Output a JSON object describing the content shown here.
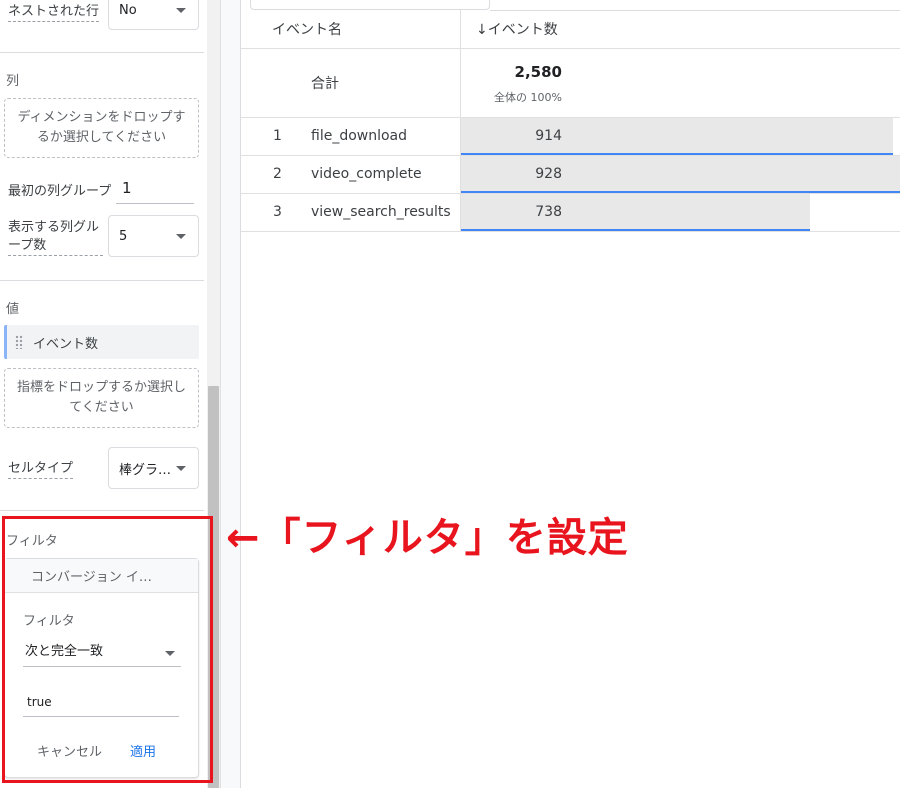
{
  "panel": {
    "nested_rows": {
      "label": "ネストされた行",
      "value": "No"
    },
    "columns": {
      "section_label": "列",
      "dropzone": "ディメンションをドロップするか選択してください",
      "first_group_label": "最初の列グループ",
      "first_group_value": "1",
      "show_groups_label": "表示する列グループ数",
      "show_groups_value": "5"
    },
    "values": {
      "section_label": "値",
      "chip": "イベント数",
      "dropzone": "指標をドロップするか選択してください"
    },
    "cell_type": {
      "label": "セルタイプ",
      "value": "棒グラ…"
    },
    "filter": {
      "section_label": "フィルタ",
      "chip": "コンバージョン イ…",
      "field_label": "フィルタ",
      "match_type": "次と完全一致",
      "value": "true",
      "cancel_label": "キャンセル",
      "apply_label": "適用"
    }
  },
  "table": {
    "col_event_name": "イベント名",
    "col_event_count": "↓イベント数",
    "total_label": "合計",
    "total_value": "2,580",
    "total_pct": "全体の 100%",
    "rows": [
      {
        "idx": "1",
        "name": "file_download",
        "value": "914",
        "fraction": 0.985
      },
      {
        "idx": "2",
        "name": "video_complete",
        "value": "928",
        "fraction": 1.0
      },
      {
        "idx": "3",
        "name": "view_search_results",
        "value": "738",
        "fraction": 0.795
      }
    ]
  },
  "annotation": {
    "text": "←「フィルタ」を設定"
  },
  "colors": {
    "accent": "#1a73e8",
    "bar_line": "#4285f4",
    "annotation": "#e8141e"
  }
}
